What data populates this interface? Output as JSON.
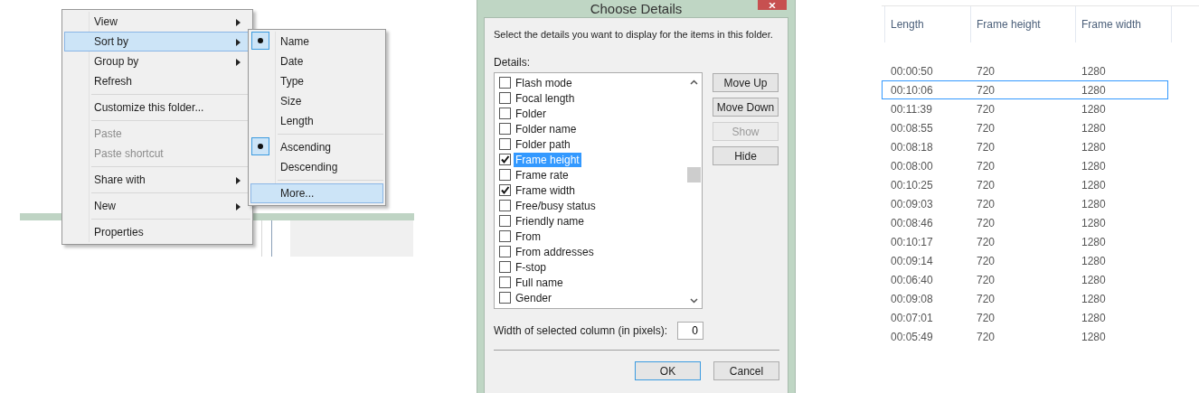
{
  "context_menu": {
    "items": [
      {
        "kind": "item",
        "label": "View",
        "submenu": true,
        "disabled": false,
        "selected": false
      },
      {
        "kind": "item",
        "label": "Sort by",
        "submenu": true,
        "disabled": false,
        "selected": true
      },
      {
        "kind": "item",
        "label": "Group by",
        "submenu": true,
        "disabled": false,
        "selected": false
      },
      {
        "kind": "item",
        "label": "Refresh",
        "submenu": false,
        "disabled": false,
        "selected": false
      },
      {
        "kind": "separator"
      },
      {
        "kind": "item",
        "label": "Customize this folder...",
        "submenu": false,
        "disabled": false,
        "selected": false
      },
      {
        "kind": "separator"
      },
      {
        "kind": "item",
        "label": "Paste",
        "submenu": false,
        "disabled": true,
        "selected": false
      },
      {
        "kind": "item",
        "label": "Paste shortcut",
        "submenu": false,
        "disabled": true,
        "selected": false
      },
      {
        "kind": "separator"
      },
      {
        "kind": "item",
        "label": "Share with",
        "submenu": true,
        "disabled": false,
        "selected": false
      },
      {
        "kind": "separator"
      },
      {
        "kind": "item",
        "label": "New",
        "submenu": true,
        "disabled": false,
        "selected": false
      },
      {
        "kind": "separator"
      },
      {
        "kind": "item",
        "label": "Properties",
        "submenu": false,
        "disabled": false,
        "selected": false
      }
    ]
  },
  "sort_submenu": {
    "items": [
      {
        "kind": "item",
        "label": "Name",
        "checked": true,
        "selected": false
      },
      {
        "kind": "item",
        "label": "Date",
        "checked": false,
        "selected": false
      },
      {
        "kind": "item",
        "label": "Type",
        "checked": false,
        "selected": false
      },
      {
        "kind": "item",
        "label": "Size",
        "checked": false,
        "selected": false
      },
      {
        "kind": "item",
        "label": "Length",
        "checked": false,
        "selected": false
      },
      {
        "kind": "separator"
      },
      {
        "kind": "item",
        "label": "Ascending",
        "checked": true,
        "selected": false
      },
      {
        "kind": "item",
        "label": "Descending",
        "checked": false,
        "selected": false
      },
      {
        "kind": "separator"
      },
      {
        "kind": "item",
        "label": "More...",
        "checked": false,
        "selected": true
      }
    ]
  },
  "dialog": {
    "title": "Choose Details",
    "instructions": "Select the details you want to display for the items in this folder.",
    "details_label": "Details:",
    "details": [
      {
        "label": "Flash mode",
        "checked": false,
        "selected": false
      },
      {
        "label": "Focal length",
        "checked": false,
        "selected": false
      },
      {
        "label": "Folder",
        "checked": false,
        "selected": false
      },
      {
        "label": "Folder name",
        "checked": false,
        "selected": false
      },
      {
        "label": "Folder path",
        "checked": false,
        "selected": false
      },
      {
        "label": "Frame height",
        "checked": true,
        "selected": true
      },
      {
        "label": "Frame rate",
        "checked": false,
        "selected": false
      },
      {
        "label": "Frame width",
        "checked": true,
        "selected": false
      },
      {
        "label": "Free/busy status",
        "checked": false,
        "selected": false
      },
      {
        "label": "Friendly name",
        "checked": false,
        "selected": false
      },
      {
        "label": "From",
        "checked": false,
        "selected": false
      },
      {
        "label": "From addresses",
        "checked": false,
        "selected": false
      },
      {
        "label": "F-stop",
        "checked": false,
        "selected": false
      },
      {
        "label": "Full name",
        "checked": false,
        "selected": false
      },
      {
        "label": "Gender",
        "checked": false,
        "selected": false
      }
    ],
    "side_buttons": [
      {
        "label": "Move Up",
        "disabled": false
      },
      {
        "label": "Move Down",
        "disabled": false
      },
      {
        "label": "Show",
        "disabled": true
      },
      {
        "label": "Hide",
        "disabled": false
      }
    ],
    "width_label": "Width of selected column (in pixels):",
    "width_value": "0",
    "footer_buttons": [
      {
        "label": "OK",
        "default": true
      },
      {
        "label": "Cancel",
        "default": false
      }
    ]
  },
  "table": {
    "columns": [
      "Length",
      "Frame height",
      "Frame width"
    ],
    "rows": [
      {
        "cells": [
          "00:00:50",
          "720",
          "1280"
        ],
        "selected": false
      },
      {
        "cells": [
          "00:10:06",
          "720",
          "1280"
        ],
        "selected": true
      },
      {
        "cells": [
          "00:11:39",
          "720",
          "1280"
        ],
        "selected": false
      },
      {
        "cells": [
          "00:08:55",
          "720",
          "1280"
        ],
        "selected": false
      },
      {
        "cells": [
          "00:08:18",
          "720",
          "1280"
        ],
        "selected": false
      },
      {
        "cells": [
          "00:08:00",
          "720",
          "1280"
        ],
        "selected": false
      },
      {
        "cells": [
          "00:10:25",
          "720",
          "1280"
        ],
        "selected": false
      },
      {
        "cells": [
          "00:09:03",
          "720",
          "1280"
        ],
        "selected": false
      },
      {
        "cells": [
          "00:08:46",
          "720",
          "1280"
        ],
        "selected": false
      },
      {
        "cells": [
          "00:10:17",
          "720",
          "1280"
        ],
        "selected": false
      },
      {
        "cells": [
          "00:09:14",
          "720",
          "1280"
        ],
        "selected": false
      },
      {
        "cells": [
          "00:06:40",
          "720",
          "1280"
        ],
        "selected": false
      },
      {
        "cells": [
          "00:09:08",
          "720",
          "1280"
        ],
        "selected": false
      },
      {
        "cells": [
          "00:07:01",
          "720",
          "1280"
        ],
        "selected": false
      },
      {
        "cells": [
          "00:05:49",
          "720",
          "1280"
        ],
        "selected": false
      }
    ]
  }
}
